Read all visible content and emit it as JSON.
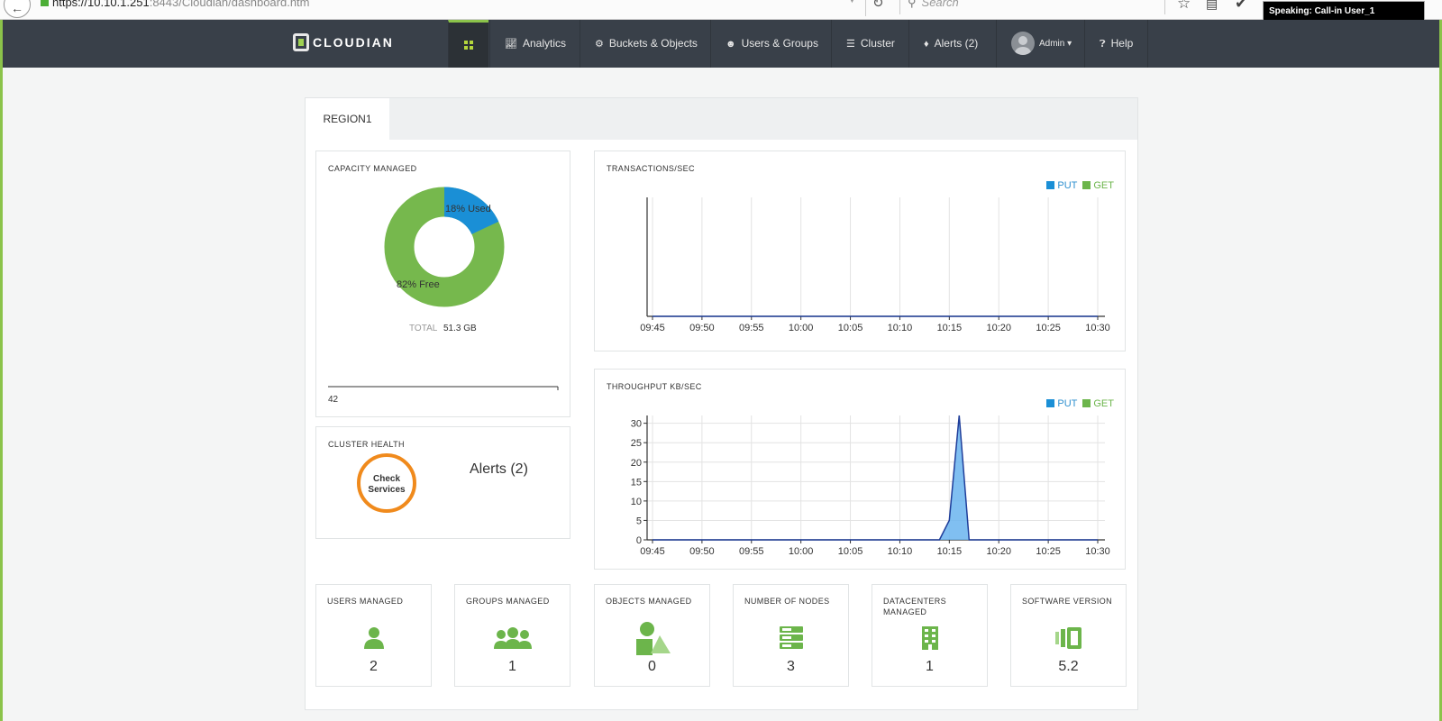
{
  "browser": {
    "url_host": "https://10.10.1.251",
    "url_rest": ":8443/Cloudian/dashboard.htm",
    "search_placeholder": "Search",
    "speaking_label": "Speaking: Call-in User_1"
  },
  "nav": {
    "brand": "CLOUDIAN",
    "items": [
      {
        "label": "Analytics",
        "icon": "line-chart-icon"
      },
      {
        "label": "Buckets & Objects",
        "icon": "gear-icon"
      },
      {
        "label": "Users & Groups",
        "icon": "users-icon"
      },
      {
        "label": "Cluster",
        "icon": "list-icon"
      },
      {
        "label": "Alerts (2)",
        "icon": "bell-icon"
      },
      {
        "label": "Admin",
        "icon": "avatar"
      },
      {
        "label": "Help",
        "icon": "question-icon"
      }
    ]
  },
  "region_tab": "REGION1",
  "capacity": {
    "title": "CAPACITY MANAGED",
    "used_label": "18% Used",
    "free_label": "82% Free",
    "used_pct": 18,
    "free_pct": 82,
    "total_label": "TOTAL",
    "total_value": "51.3 GB",
    "scale_value": "42",
    "colors": {
      "used": "#1a8fd6",
      "free": "#76b84d"
    }
  },
  "health": {
    "title": "CLUSTER HEALTH",
    "status_line1": "Check",
    "status_line2": "Services",
    "alerts": "Alerts (2)",
    "ring_color": "#f08a1c"
  },
  "legend": {
    "put": "PUT",
    "get": "GET",
    "put_color": "#1a8fd6",
    "get_color": "#6cb54b"
  },
  "transactions": {
    "title": "TRANSACTIONS/SEC"
  },
  "throughput": {
    "title": "THROUGHPUT KB/SEC"
  },
  "chart_data": [
    {
      "type": "line",
      "title": "TRANSACTIONS/SEC",
      "x": [
        "09:45",
        "09:50",
        "09:55",
        "10:00",
        "10:05",
        "10:10",
        "10:15",
        "10:20",
        "10:25",
        "10:30"
      ],
      "series": [
        {
          "name": "PUT",
          "values": [
            0,
            0,
            0,
            0,
            0,
            0,
            0,
            0,
            0,
            0
          ]
        },
        {
          "name": "GET",
          "values": [
            0,
            0,
            0,
            0,
            0,
            0,
            0,
            0,
            0,
            0
          ]
        }
      ],
      "grid": true,
      "legend": "top-right"
    },
    {
      "type": "area",
      "title": "THROUGHPUT KB/SEC",
      "x": [
        "09:45",
        "09:50",
        "09:55",
        "10:00",
        "10:05",
        "10:10",
        "10:15",
        "10:20",
        "10:25",
        "10:30"
      ],
      "yticks": [
        0,
        5,
        10,
        15,
        20,
        25,
        30
      ],
      "ylim": [
        0,
        32
      ],
      "series": [
        {
          "name": "PUT",
          "points": [
            [
              "09:45",
              0
            ],
            [
              "10:14",
              0
            ],
            [
              "10:15",
              5
            ],
            [
              "10:16",
              32
            ],
            [
              "10:17",
              0
            ],
            [
              "10:30",
              0
            ]
          ]
        }
      ],
      "grid": true,
      "legend": "top-right"
    }
  ],
  "stats": [
    {
      "title": "USERS MANAGED",
      "value": "2",
      "icon": "user-icon"
    },
    {
      "title": "GROUPS MANAGED",
      "value": "1",
      "icon": "group-icon"
    },
    {
      "title": "OBJECTS MANAGED",
      "value": "0",
      "icon": "shapes-icon"
    },
    {
      "title": "NUMBER OF NODES",
      "value": "3",
      "icon": "server-icon"
    },
    {
      "title": "DATACENTERS MANAGED",
      "value": "1",
      "icon": "building-icon"
    },
    {
      "title": "SOFTWARE VERSION",
      "value": "5.2",
      "icon": "version-icon"
    }
  ],
  "accent_color": "#6cb54b"
}
